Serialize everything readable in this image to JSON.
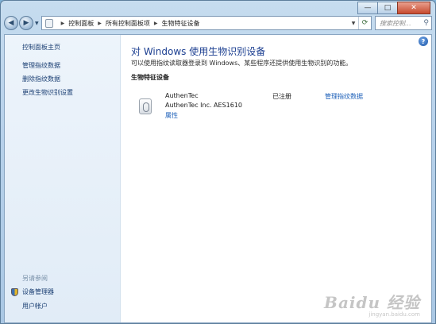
{
  "window": {
    "controls": {
      "minimize": "—",
      "maximize": "□",
      "close": "✕"
    }
  },
  "nav": {
    "back_icon": "back-arrow-icon",
    "forward_icon": "forward-arrow-icon",
    "breadcrumb": [
      "控制面板",
      "所有控制面板项",
      "生物特征设备"
    ],
    "search_placeholder": "搜索控制..."
  },
  "sidebar": {
    "home": "控制面板主页",
    "links": [
      "管理指纹数据",
      "删除指纹数据",
      "更改生物识别设置"
    ],
    "see_also_header": "另请参阅",
    "see_also": [
      {
        "label": "设备管理器",
        "icon": "shield-icon"
      },
      {
        "label": "用户帐户"
      }
    ]
  },
  "main": {
    "title": "对 Windows 使用生物识别设备",
    "description": "可以使用指纹读取器登录到 Windows、某些程序还提供使用生物识别的功能。",
    "section_header": "生物特征设备",
    "device": {
      "name": "AuthenTec",
      "model": "AuthenTec Inc. AES1610",
      "properties_link": "属性",
      "status": "已注册",
      "manage_link": "管理指纹数据"
    }
  },
  "watermark": {
    "logo": "Baidu 经验",
    "url": "jingyan.baidu.com"
  }
}
